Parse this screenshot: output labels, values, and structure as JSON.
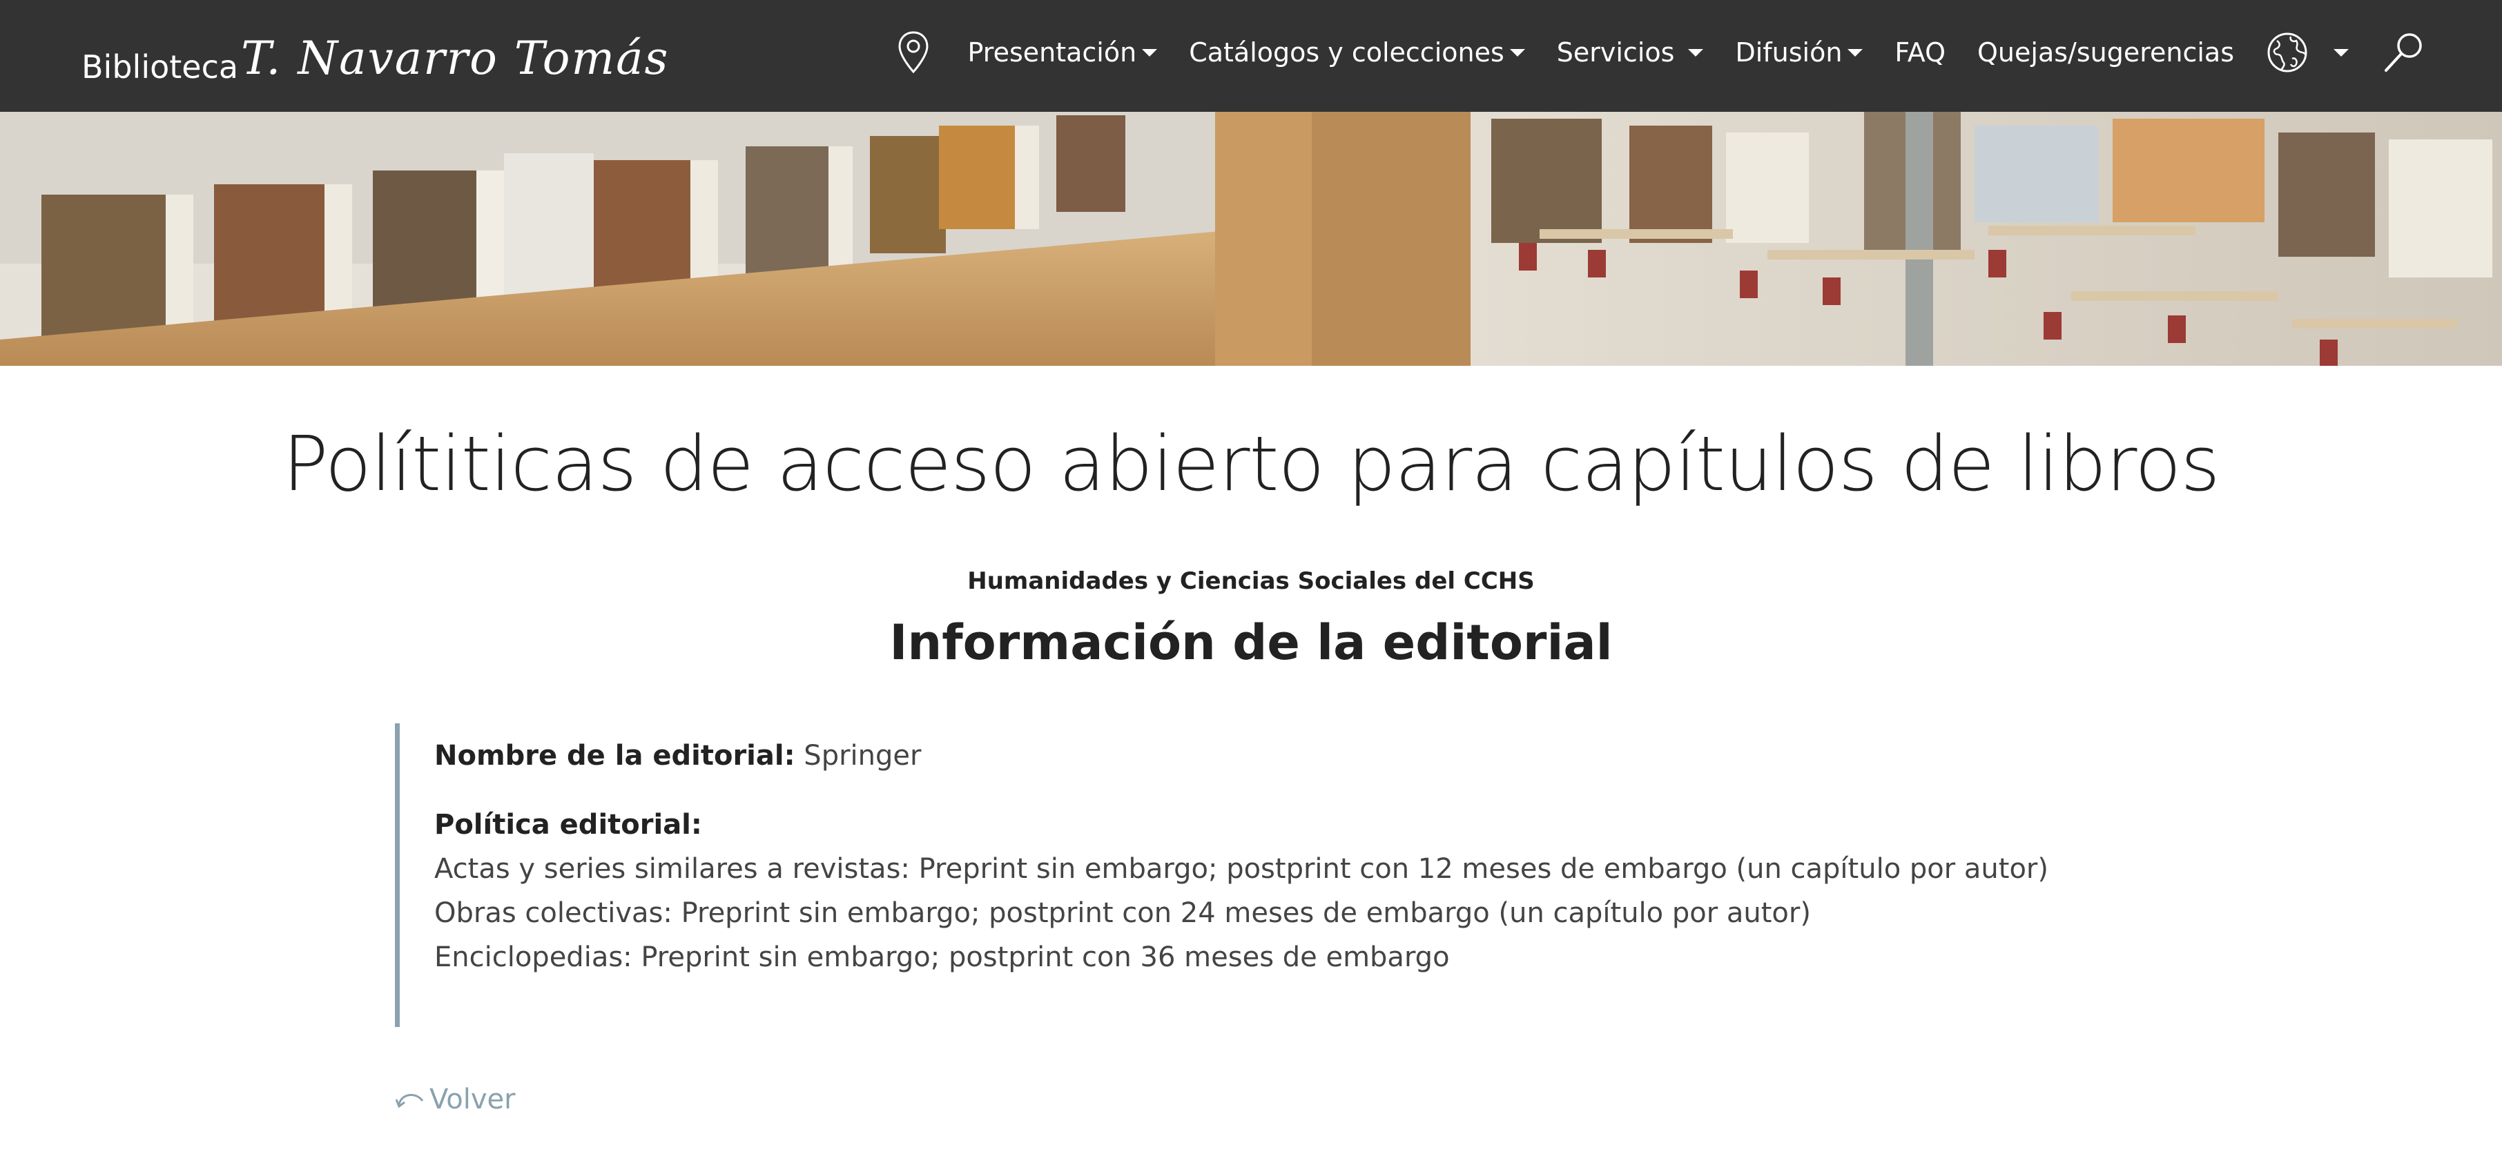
{
  "brand": {
    "prefix": "Biblioteca",
    "script": "T. Navarro Tomás"
  },
  "nav": {
    "items": [
      {
        "label": "Presentación",
        "dropdown": true
      },
      {
        "label": "Catálogos y colecciones",
        "dropdown": true
      },
      {
        "label": "Servicios",
        "dropdown": true
      },
      {
        "label": "Difusión",
        "dropdown": true
      },
      {
        "label": "FAQ",
        "dropdown": false
      },
      {
        "label": "Quejas/sugerencias",
        "dropdown": false
      }
    ],
    "icons": {
      "location": "map-pin-icon",
      "language": "globe-icon",
      "search": "search-icon"
    }
  },
  "page": {
    "title": "Polítiticas de acceso abierto para capítulos de libros",
    "subtitle": "Humanidades y Ciencias Sociales del CCHS",
    "section_title": "Información de la editorial"
  },
  "publisher": {
    "name_label": "Nombre de la editorial:",
    "name_value": "Springer",
    "policy_label": "Política editorial:",
    "policy_lines": [
      "Actas y series similares a revistas: Preprint sin embargo; postprint con 12 meses de embargo (un capítulo por autor)",
      "Obras colectivas: Preprint sin embargo; postprint con 24 meses de embargo (un capítulo por autor)",
      "Enciclopedias: Preprint sin embargo; postprint con 36 meses de embargo"
    ]
  },
  "back": {
    "label": "Volver"
  },
  "colors": {
    "navbar": "#333333",
    "accent": "#8aa1ae",
    "text": "#222222"
  }
}
